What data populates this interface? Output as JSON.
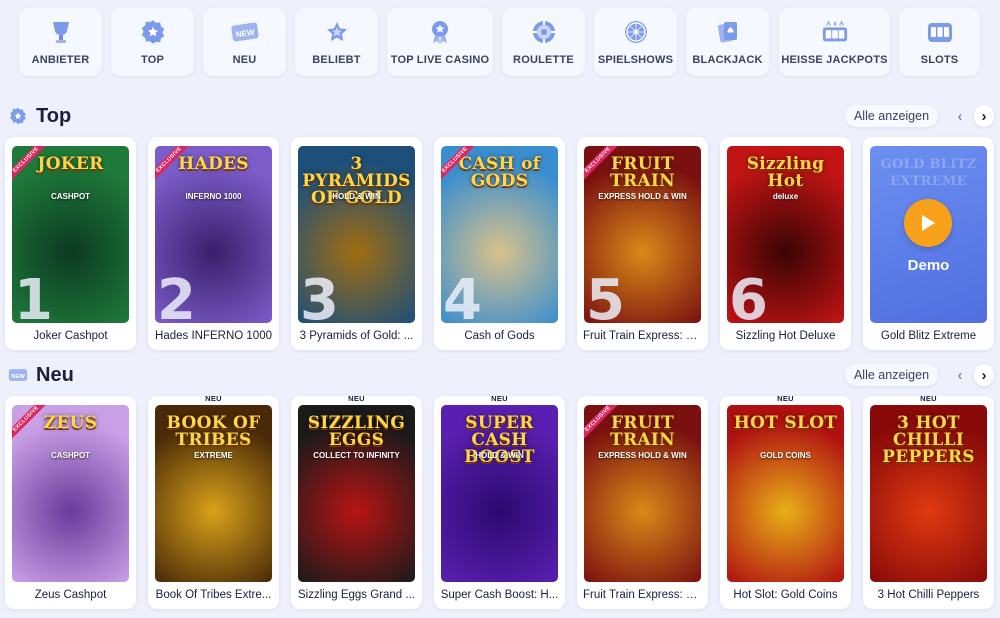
{
  "categories": [
    {
      "label": "ANBIETER",
      "icon": "trophy-icon"
    },
    {
      "label": "TOP",
      "icon": "star-badge-icon"
    },
    {
      "label": "NEU",
      "icon": "new-badge-icon"
    },
    {
      "label": "BELIEBT",
      "icon": "star-icon"
    },
    {
      "label": "TOP LIVE CASINO",
      "icon": "medal-icon"
    },
    {
      "label": "ROULETTE",
      "icon": "roulette-icon"
    },
    {
      "label": "SPIELSHOWS",
      "icon": "wheel-icon"
    },
    {
      "label": "BLACKJACK",
      "icon": "cards-icon"
    },
    {
      "label": "HEISSE JACKPOTS",
      "icon": "jackpot-icon"
    },
    {
      "label": "SLOTS",
      "icon": "slot-machine-icon"
    }
  ],
  "top_section": {
    "title": "Top",
    "icon": "star-badge-icon",
    "show_all": "Alle anzeigen",
    "games": [
      {
        "name": "Joker Cashpot",
        "rank": "1",
        "badge": "EXCLUSIVE",
        "art_title": "JOKER",
        "art_sub": "CASHPOT",
        "colors": [
          "#1f7a3a",
          "#0b3a22"
        ]
      },
      {
        "name": "Hades INFERNO 1000",
        "rank": "2",
        "badge": "EXCLUSIVE",
        "art_title": "HADES",
        "art_sub": "INFERNO 1000",
        "colors": [
          "#7c5cc9",
          "#3a1f6b"
        ]
      },
      {
        "name": "3 Pyramids of Gold: ...",
        "rank": "3",
        "badge": "",
        "art_title": "3 PYRAMIDS OF GOLD",
        "art_sub": "HOLD & WIN",
        "colors": [
          "#1c4f7a",
          "#a06d10"
        ]
      },
      {
        "name": "Cash of Gods",
        "rank": "4",
        "badge": "EXCLUSIVE",
        "art_title": "CASH of GODS",
        "art_sub": "",
        "colors": [
          "#3a8ecf",
          "#d9c28a"
        ]
      },
      {
        "name": "Fruit Train Express: H...",
        "rank": "5",
        "badge": "EXCLUSIVE",
        "art_title": "FRUIT TRAIN",
        "art_sub": "EXPRESS HOLD & WIN",
        "colors": [
          "#7a1010",
          "#d98a18"
        ]
      },
      {
        "name": "Sizzling Hot Deluxe",
        "rank": "6",
        "badge": "",
        "art_title": "Sizzling Hot",
        "art_sub": "deluxe",
        "colors": [
          "#c21414",
          "#3a0404"
        ]
      },
      {
        "name": "Gold Blitz Extreme",
        "rank": "",
        "badge": "",
        "art_title": "GOLD BLITZ EXTREME",
        "art_sub": "",
        "demo": "Demo",
        "colors": [
          "#6d8ff0",
          "#4f6fe0"
        ]
      }
    ]
  },
  "new_section": {
    "title": "Neu",
    "icon": "new-badge-icon",
    "show_all": "Alle anzeigen",
    "games": [
      {
        "name": "Zeus Cashpot",
        "tag": "",
        "badge": "EXCLUSIVE",
        "art_title": "ZEUS",
        "art_sub": "CASHPOT",
        "colors": [
          "#c9a0e6",
          "#6a3a9a"
        ]
      },
      {
        "name": "Book Of Tribes Extre...",
        "tag": "NEU",
        "badge": "",
        "art_title": "BOOK OF TRIBES",
        "art_sub": "EXTREME",
        "colors": [
          "#4a2a08",
          "#d9a21a"
        ]
      },
      {
        "name": "Sizzling Eggs Grand ...",
        "tag": "NEU",
        "badge": "",
        "art_title": "SIZZLING EGGS",
        "art_sub": "COLLECT TO INFINITY",
        "colors": [
          "#1a1a1a",
          "#b81414"
        ]
      },
      {
        "name": "Super Cash Boost: H...",
        "tag": "NEU",
        "badge": "",
        "art_title": "SUPER CASH BOOST",
        "art_sub": "HOLD & WIN",
        "colors": [
          "#5a1fb0",
          "#2a0a70"
        ]
      },
      {
        "name": "Fruit Train Express: H...",
        "tag": "",
        "badge": "EXCLUSIVE",
        "art_title": "FRUIT TRAIN",
        "art_sub": "EXPRESS HOLD & WIN",
        "colors": [
          "#7a1010",
          "#d98a18"
        ]
      },
      {
        "name": "Hot Slot: Gold Coins",
        "tag": "NEU",
        "badge": "",
        "art_title": "HOT SLOT",
        "art_sub": "GOLD COINS",
        "colors": [
          "#b01010",
          "#e8b018"
        ]
      },
      {
        "name": "3 Hot Chilli Peppers",
        "tag": "NEU",
        "badge": "",
        "art_title": "3 HOT CHILLI PEPPERS",
        "art_sub": "",
        "colors": [
          "#8a0a0a",
          "#e03a10"
        ]
      }
    ]
  },
  "colors": {
    "background": "#eef1fb",
    "accent_orange": "#f7a21a",
    "exclusive_red": "#e0245e",
    "icon_blue": "#6f8fe6"
  }
}
